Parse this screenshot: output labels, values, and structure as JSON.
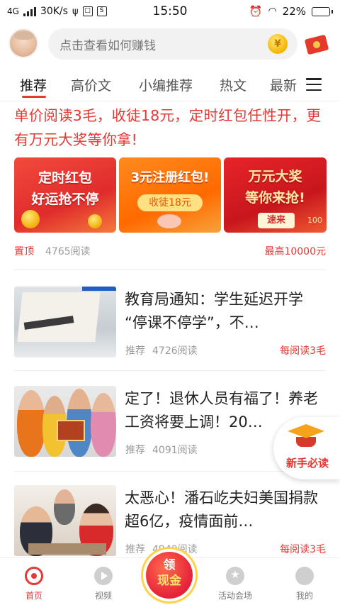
{
  "status_bar": {
    "network": "4G",
    "speed": "30K/s",
    "time": "15:50",
    "battery": "22%",
    "battery_level": 0.22
  },
  "header": {
    "search_placeholder": "点击查看如何赚钱"
  },
  "tabs": [
    "推荐",
    "高价文",
    "小编推荐",
    "热文",
    "最新"
  ],
  "promo": {
    "title": "单价阅读3毛，收徒18元，定时红包任性开，更有万元大奖等你拿!",
    "banners": [
      {
        "line1": "定时红包",
        "line2": "好运抢不停"
      },
      {
        "line1": "3元注册红包!",
        "pill": "收徒18元"
      },
      {
        "line1": "万元大奖",
        "line2": "等你来抢!",
        "button": "速来",
        "tag": "100"
      }
    ],
    "pin_label": "置顶",
    "views": "4765阅读",
    "reward": "最高10000元"
  },
  "articles": [
    {
      "title": "教育局通知：学生延迟开学 “停课不停学”，不…",
      "source": "推荐",
      "views": "4726阅读",
      "reward": "每阅读3毛"
    },
    {
      "title": "定了！退休人员有福了！养老工资将要上调！20…",
      "source": "推荐",
      "views": "4091阅读",
      "reward": ""
    },
    {
      "title": "太恶心！潘石屹夫妇美国捐款超6亿，疫情面前…",
      "source": "推荐",
      "views": "4940阅读",
      "reward": "每阅读3毛"
    }
  ],
  "floating_badge": {
    "label": "新手必读"
  },
  "bottom_nav": {
    "items": [
      "首页",
      "视频",
      "活动会场",
      "我的"
    ],
    "cash_line1": "领",
    "cash_line2": "现金"
  },
  "colors": {
    "accent": "#e53935",
    "gray_text": "#9a9a9a"
  }
}
